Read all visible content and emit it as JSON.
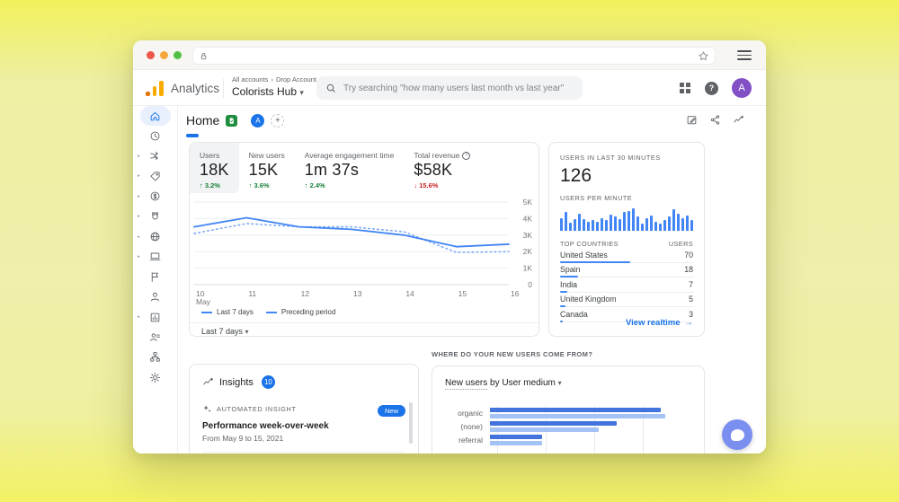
{
  "glyphs": {
    "caret": "▾",
    "breadcrumb_sep": "›",
    "plus": "+",
    "question_mark": "?",
    "arrow_right": "→",
    "chevron": "▸"
  },
  "header": {
    "brand": "Analytics",
    "breadcrumb_accounts": "All accounts",
    "breadcrumb_account": "Drop Account",
    "property_name": "Colorists Hub",
    "search_placeholder": "Try searching \"how many users last month vs last year\"",
    "avatar_initial": "A"
  },
  "nav": {
    "page_title": "Home",
    "avatar_initial": "A"
  },
  "sidebar": {
    "items": [
      {
        "icon": "home-icon",
        "selected": true,
        "chevron": false
      },
      {
        "icon": "clock-icon",
        "chevron": false
      },
      {
        "icon": "lifecycle-icon",
        "chevron": true
      },
      {
        "icon": "tag-icon",
        "chevron": true
      },
      {
        "icon": "monetization-icon",
        "chevron": true
      },
      {
        "icon": "retention-magnet-icon",
        "chevron": true
      },
      {
        "icon": "demographics-globe-icon",
        "chevron": true
      },
      {
        "icon": "tech-devices-icon",
        "chevron": true
      },
      {
        "icon": "flag-icon",
        "chevron": false
      },
      {
        "icon": "user-icon",
        "chevron": false
      },
      {
        "icon": "reports-library-icon",
        "chevron": true
      },
      {
        "icon": "audiences-icon",
        "chevron": false
      },
      {
        "icon": "structure-icon",
        "chevron": false
      },
      {
        "icon": "admin-gear-icon",
        "chevron": false
      }
    ]
  },
  "overview": {
    "metrics": [
      {
        "label": "Users",
        "value": "18K",
        "arrow": "↑",
        "delta": "3.2%",
        "direction": "up",
        "selected": true,
        "has_help": false
      },
      {
        "label": "New users",
        "value": "15K",
        "arrow": "↑",
        "delta": "3.6%",
        "direction": "up",
        "selected": false,
        "has_help": false
      },
      {
        "label": "Average engagement time",
        "value": "1m 37s",
        "arrow": "↑",
        "delta": "2.4%",
        "direction": "up",
        "selected": false,
        "has_help": false
      },
      {
        "label": "Total revenue",
        "value": "$58K",
        "arrow": "↓",
        "delta": "15.6%",
        "direction": "down",
        "selected": false,
        "has_help": true
      }
    ],
    "legend": [
      {
        "label": "Last 7 days",
        "style": "solid"
      },
      {
        "label": "Preceding period",
        "style": "dashed"
      }
    ],
    "footer_range": "Last 7 days"
  },
  "realtime": {
    "title": "USERS IN LAST 30 MINUTES",
    "count": "126",
    "per_minute_label": "USERS PER MINUTE",
    "countries_header_left": "TOP COUNTRIES",
    "countries_header_right": "USERS",
    "countries": [
      {
        "name": "United States",
        "users": 70
      },
      {
        "name": "Spain",
        "users": 18
      },
      {
        "name": "India",
        "users": 7
      },
      {
        "name": "United Kingdom",
        "users": 5
      },
      {
        "name": "Canada",
        "users": 3
      }
    ],
    "link_label": "View realtime"
  },
  "insights": {
    "title": "Insights",
    "badge": "10",
    "kicker": "AUTOMATED INSIGHT",
    "new_badge": "New",
    "headline": "Performance week-over-week",
    "subtext": "From May 9 to 15, 2021"
  },
  "acquisition": {
    "section_title": "WHERE DO YOUR NEW USERS COME FROM?",
    "control_primary": "New users",
    "control_secondary": "by User medium"
  },
  "chart_data": [
    {
      "type": "line",
      "title": "Users over time",
      "x": [
        "10",
        "11",
        "12",
        "13",
        "14",
        "15",
        "16"
      ],
      "x_sublabel": "May",
      "series": [
        {
          "name": "Last 7 days",
          "style": "solid",
          "values": [
            3500,
            4050,
            3500,
            3350,
            3000,
            2300,
            2450
          ]
        },
        {
          "name": "Preceding period",
          "style": "dashed",
          "values": [
            3100,
            3700,
            3500,
            3500,
            3200,
            1950,
            2000
          ]
        }
      ],
      "ylim": [
        0,
        5000
      ],
      "yticks": [
        0,
        1000,
        2000,
        3000,
        4000,
        5000
      ],
      "ytick_labels": [
        "0",
        "1K",
        "2K",
        "3K",
        "4K",
        "5K"
      ],
      "grid": true,
      "legend_position": "bottom"
    },
    {
      "type": "bar",
      "title": "Users per minute",
      "unit": "relative_pct",
      "values": [
        55,
        80,
        35,
        50,
        75,
        50,
        40,
        45,
        40,
        52,
        45,
        70,
        60,
        50,
        80,
        85,
        95,
        60,
        30,
        52,
        65,
        40,
        30,
        45,
        60,
        92,
        75,
        55,
        65,
        45
      ]
    },
    {
      "type": "bar",
      "orientation": "horizontal",
      "title": "New users by User medium",
      "unit": "relative_pct",
      "categories": [
        "organic",
        "(none)",
        "referral"
      ],
      "series": [
        {
          "name": "series_a",
          "values": [
            85,
            63,
            26
          ]
        },
        {
          "name": "series_b",
          "values": [
            87,
            54,
            26
          ]
        }
      ],
      "grid": true
    }
  ],
  "colors": {
    "accent_blue": "#1a73e8",
    "chart_blue": "#4285f4",
    "chart_blue_light": "#a5c2f4",
    "bar_dark": "#4374dd",
    "delta_up_green": "#188038",
    "delta_down_red": "#c5221f",
    "avatar_purple": "#8250c4",
    "fab_blue": "#7b8ff0",
    "logo_orange": "#f9ab00",
    "logo_orange_dark": "#e37400",
    "background_yellow": "#f0f07a"
  }
}
